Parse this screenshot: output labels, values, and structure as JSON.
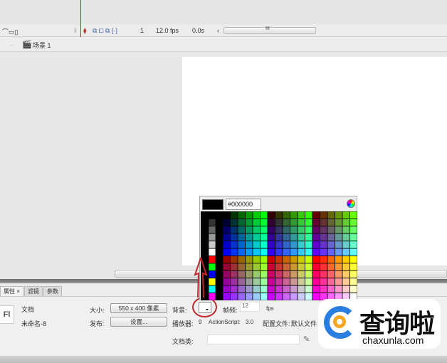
{
  "timeline": {
    "frame": "1",
    "fps": "12.0 fps",
    "time": "0.0s",
    "scroll_grip": "III"
  },
  "scene": {
    "label": "场景 1"
  },
  "panel": {
    "tabs": [
      {
        "label": "属性 ×"
      },
      {
        "label": "滤镜"
      },
      {
        "label": "参数"
      }
    ],
    "logo": "Fl",
    "doc_type": "文档",
    "doc_name": "未命名-8",
    "size_label": "大小:",
    "size_value": "550 x 400 像素",
    "publish_label": "发布:",
    "publish_button": "设置...",
    "bg_label": "背景:",
    "fps_label": "帧频:",
    "fps_value": "12",
    "fps_unit": "fps",
    "player_label": "播放器:",
    "player_value": "9",
    "as_label": "ActionScript:",
    "as_value": "3.0",
    "profile_label": "配置文件:",
    "profile_value": "默认文件",
    "docclass_label": "文档类:",
    "docclass_value": ""
  },
  "color_picker": {
    "hex": "#000000",
    "current_color": "#000000",
    "left_column": [
      "#000000",
      "#333333",
      "#666666",
      "#999999",
      "#CCCCCC",
      "#FFFFFF",
      "#FF0000",
      "#00FF00",
      "#0000FF",
      "#FFFF00",
      "#00FFFF",
      "#FF00FF"
    ]
  },
  "watermark": {
    "cn": "查询啦",
    "en": "chaxunla.com"
  },
  "colors": {
    "highlight": "#c0282a",
    "playhead": "#b03030"
  }
}
